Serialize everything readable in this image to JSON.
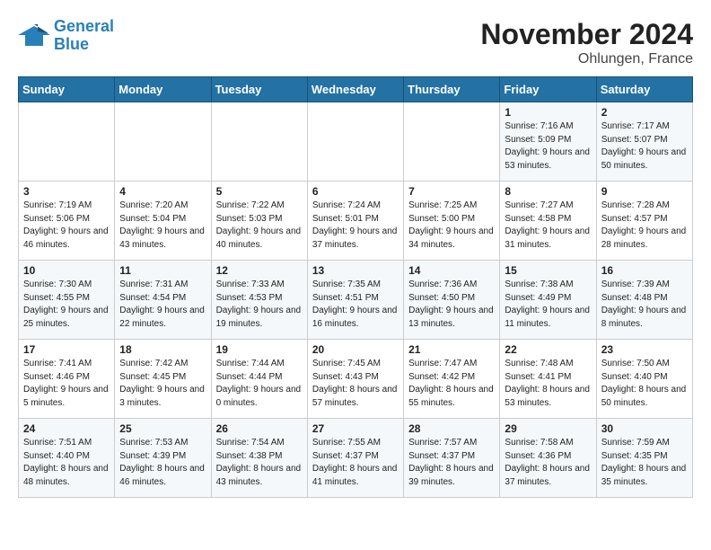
{
  "header": {
    "logo_line1": "General",
    "logo_line2": "Blue",
    "month_title": "November 2024",
    "location": "Ohlungen, France"
  },
  "days_of_week": [
    "Sunday",
    "Monday",
    "Tuesday",
    "Wednesday",
    "Thursday",
    "Friday",
    "Saturday"
  ],
  "weeks": [
    [
      {
        "day": "",
        "info": ""
      },
      {
        "day": "",
        "info": ""
      },
      {
        "day": "",
        "info": ""
      },
      {
        "day": "",
        "info": ""
      },
      {
        "day": "",
        "info": ""
      },
      {
        "day": "1",
        "info": "Sunrise: 7:16 AM\nSunset: 5:09 PM\nDaylight: 9 hours and 53 minutes."
      },
      {
        "day": "2",
        "info": "Sunrise: 7:17 AM\nSunset: 5:07 PM\nDaylight: 9 hours and 50 minutes."
      }
    ],
    [
      {
        "day": "3",
        "info": "Sunrise: 7:19 AM\nSunset: 5:06 PM\nDaylight: 9 hours and 46 minutes."
      },
      {
        "day": "4",
        "info": "Sunrise: 7:20 AM\nSunset: 5:04 PM\nDaylight: 9 hours and 43 minutes."
      },
      {
        "day": "5",
        "info": "Sunrise: 7:22 AM\nSunset: 5:03 PM\nDaylight: 9 hours and 40 minutes."
      },
      {
        "day": "6",
        "info": "Sunrise: 7:24 AM\nSunset: 5:01 PM\nDaylight: 9 hours and 37 minutes."
      },
      {
        "day": "7",
        "info": "Sunrise: 7:25 AM\nSunset: 5:00 PM\nDaylight: 9 hours and 34 minutes."
      },
      {
        "day": "8",
        "info": "Sunrise: 7:27 AM\nSunset: 4:58 PM\nDaylight: 9 hours and 31 minutes."
      },
      {
        "day": "9",
        "info": "Sunrise: 7:28 AM\nSunset: 4:57 PM\nDaylight: 9 hours and 28 minutes."
      }
    ],
    [
      {
        "day": "10",
        "info": "Sunrise: 7:30 AM\nSunset: 4:55 PM\nDaylight: 9 hours and 25 minutes."
      },
      {
        "day": "11",
        "info": "Sunrise: 7:31 AM\nSunset: 4:54 PM\nDaylight: 9 hours and 22 minutes."
      },
      {
        "day": "12",
        "info": "Sunrise: 7:33 AM\nSunset: 4:53 PM\nDaylight: 9 hours and 19 minutes."
      },
      {
        "day": "13",
        "info": "Sunrise: 7:35 AM\nSunset: 4:51 PM\nDaylight: 9 hours and 16 minutes."
      },
      {
        "day": "14",
        "info": "Sunrise: 7:36 AM\nSunset: 4:50 PM\nDaylight: 9 hours and 13 minutes."
      },
      {
        "day": "15",
        "info": "Sunrise: 7:38 AM\nSunset: 4:49 PM\nDaylight: 9 hours and 11 minutes."
      },
      {
        "day": "16",
        "info": "Sunrise: 7:39 AM\nSunset: 4:48 PM\nDaylight: 9 hours and 8 minutes."
      }
    ],
    [
      {
        "day": "17",
        "info": "Sunrise: 7:41 AM\nSunset: 4:46 PM\nDaylight: 9 hours and 5 minutes."
      },
      {
        "day": "18",
        "info": "Sunrise: 7:42 AM\nSunset: 4:45 PM\nDaylight: 9 hours and 3 minutes."
      },
      {
        "day": "19",
        "info": "Sunrise: 7:44 AM\nSunset: 4:44 PM\nDaylight: 9 hours and 0 minutes."
      },
      {
        "day": "20",
        "info": "Sunrise: 7:45 AM\nSunset: 4:43 PM\nDaylight: 8 hours and 57 minutes."
      },
      {
        "day": "21",
        "info": "Sunrise: 7:47 AM\nSunset: 4:42 PM\nDaylight: 8 hours and 55 minutes."
      },
      {
        "day": "22",
        "info": "Sunrise: 7:48 AM\nSunset: 4:41 PM\nDaylight: 8 hours and 53 minutes."
      },
      {
        "day": "23",
        "info": "Sunrise: 7:50 AM\nSunset: 4:40 PM\nDaylight: 8 hours and 50 minutes."
      }
    ],
    [
      {
        "day": "24",
        "info": "Sunrise: 7:51 AM\nSunset: 4:40 PM\nDaylight: 8 hours and 48 minutes."
      },
      {
        "day": "25",
        "info": "Sunrise: 7:53 AM\nSunset: 4:39 PM\nDaylight: 8 hours and 46 minutes."
      },
      {
        "day": "26",
        "info": "Sunrise: 7:54 AM\nSunset: 4:38 PM\nDaylight: 8 hours and 43 minutes."
      },
      {
        "day": "27",
        "info": "Sunrise: 7:55 AM\nSunset: 4:37 PM\nDaylight: 8 hours and 41 minutes."
      },
      {
        "day": "28",
        "info": "Sunrise: 7:57 AM\nSunset: 4:37 PM\nDaylight: 8 hours and 39 minutes."
      },
      {
        "day": "29",
        "info": "Sunrise: 7:58 AM\nSunset: 4:36 PM\nDaylight: 8 hours and 37 minutes."
      },
      {
        "day": "30",
        "info": "Sunrise: 7:59 AM\nSunset: 4:35 PM\nDaylight: 8 hours and 35 minutes."
      }
    ]
  ]
}
